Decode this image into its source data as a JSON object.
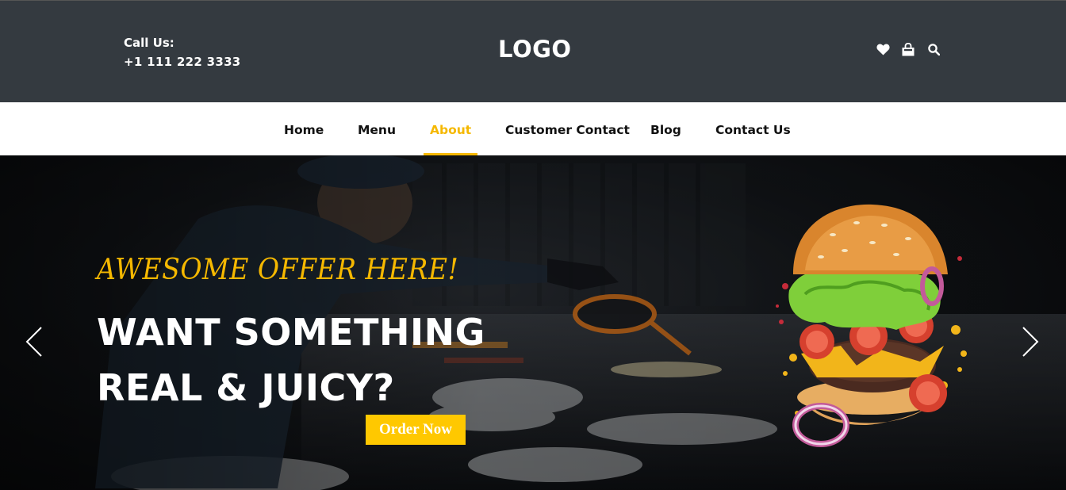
{
  "header": {
    "call_label": "Call Us:",
    "phone": "+1 111 222 3333",
    "logo": "LOGO",
    "icons": [
      "heart-icon",
      "shopping-bag-icon",
      "search-icon"
    ]
  },
  "nav": {
    "items": [
      {
        "label": "Home"
      },
      {
        "label": "Menu"
      },
      {
        "label": "About"
      },
      {
        "label": "Customer Contact"
      },
      {
        "label": "Blog"
      },
      {
        "label": "Contact Us"
      }
    ],
    "active": "About"
  },
  "hero": {
    "tagline": "AWESOME OFFER HERE!",
    "headline_line1": "WANT SOMETHING",
    "headline_line2": "REAL & JUICY?",
    "cta": "Order Now",
    "prev_icon": "chevron-left-icon",
    "next_icon": "chevron-right-icon"
  },
  "colors": {
    "topbar": "#343a40",
    "accent": "#f5b800",
    "button": "#ffc800"
  }
}
